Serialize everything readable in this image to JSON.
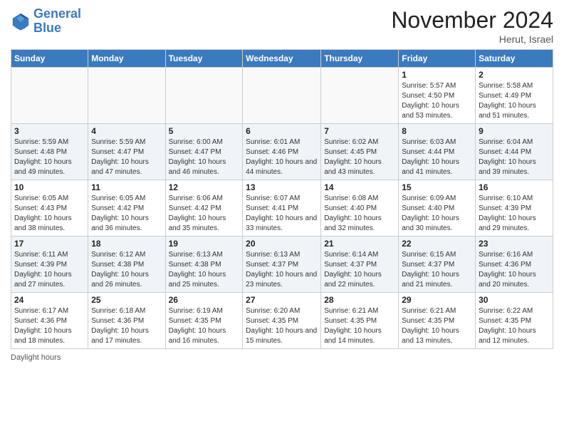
{
  "logo": {
    "text_general": "General",
    "text_blue": "Blue"
  },
  "header": {
    "month": "November 2024",
    "location": "Herut, Israel"
  },
  "days_of_week": [
    "Sunday",
    "Monday",
    "Tuesday",
    "Wednesday",
    "Thursday",
    "Friday",
    "Saturday"
  ],
  "weeks": [
    [
      {
        "day": "",
        "sunrise": "",
        "sunset": "",
        "daylight": ""
      },
      {
        "day": "",
        "sunrise": "",
        "sunset": "",
        "daylight": ""
      },
      {
        "day": "",
        "sunrise": "",
        "sunset": "",
        "daylight": ""
      },
      {
        "day": "",
        "sunrise": "",
        "sunset": "",
        "daylight": ""
      },
      {
        "day": "",
        "sunrise": "",
        "sunset": "",
        "daylight": ""
      },
      {
        "day": "1",
        "sunrise": "Sunrise: 5:57 AM",
        "sunset": "Sunset: 4:50 PM",
        "daylight": "Daylight: 10 hours and 53 minutes."
      },
      {
        "day": "2",
        "sunrise": "Sunrise: 5:58 AM",
        "sunset": "Sunset: 4:49 PM",
        "daylight": "Daylight: 10 hours and 51 minutes."
      }
    ],
    [
      {
        "day": "3",
        "sunrise": "Sunrise: 5:59 AM",
        "sunset": "Sunset: 4:48 PM",
        "daylight": "Daylight: 10 hours and 49 minutes."
      },
      {
        "day": "4",
        "sunrise": "Sunrise: 5:59 AM",
        "sunset": "Sunset: 4:47 PM",
        "daylight": "Daylight: 10 hours and 47 minutes."
      },
      {
        "day": "5",
        "sunrise": "Sunrise: 6:00 AM",
        "sunset": "Sunset: 4:47 PM",
        "daylight": "Daylight: 10 hours and 46 minutes."
      },
      {
        "day": "6",
        "sunrise": "Sunrise: 6:01 AM",
        "sunset": "Sunset: 4:46 PM",
        "daylight": "Daylight: 10 hours and 44 minutes."
      },
      {
        "day": "7",
        "sunrise": "Sunrise: 6:02 AM",
        "sunset": "Sunset: 4:45 PM",
        "daylight": "Daylight: 10 hours and 43 minutes."
      },
      {
        "day": "8",
        "sunrise": "Sunrise: 6:03 AM",
        "sunset": "Sunset: 4:44 PM",
        "daylight": "Daylight: 10 hours and 41 minutes."
      },
      {
        "day": "9",
        "sunrise": "Sunrise: 6:04 AM",
        "sunset": "Sunset: 4:44 PM",
        "daylight": "Daylight: 10 hours and 39 minutes."
      }
    ],
    [
      {
        "day": "10",
        "sunrise": "Sunrise: 6:05 AM",
        "sunset": "Sunset: 4:43 PM",
        "daylight": "Daylight: 10 hours and 38 minutes."
      },
      {
        "day": "11",
        "sunrise": "Sunrise: 6:05 AM",
        "sunset": "Sunset: 4:42 PM",
        "daylight": "Daylight: 10 hours and 36 minutes."
      },
      {
        "day": "12",
        "sunrise": "Sunrise: 6:06 AM",
        "sunset": "Sunset: 4:42 PM",
        "daylight": "Daylight: 10 hours and 35 minutes."
      },
      {
        "day": "13",
        "sunrise": "Sunrise: 6:07 AM",
        "sunset": "Sunset: 4:41 PM",
        "daylight": "Daylight: 10 hours and 33 minutes."
      },
      {
        "day": "14",
        "sunrise": "Sunrise: 6:08 AM",
        "sunset": "Sunset: 4:40 PM",
        "daylight": "Daylight: 10 hours and 32 minutes."
      },
      {
        "day": "15",
        "sunrise": "Sunrise: 6:09 AM",
        "sunset": "Sunset: 4:40 PM",
        "daylight": "Daylight: 10 hours and 30 minutes."
      },
      {
        "day": "16",
        "sunrise": "Sunrise: 6:10 AM",
        "sunset": "Sunset: 4:39 PM",
        "daylight": "Daylight: 10 hours and 29 minutes."
      }
    ],
    [
      {
        "day": "17",
        "sunrise": "Sunrise: 6:11 AM",
        "sunset": "Sunset: 4:39 PM",
        "daylight": "Daylight: 10 hours and 27 minutes."
      },
      {
        "day": "18",
        "sunrise": "Sunrise: 6:12 AM",
        "sunset": "Sunset: 4:38 PM",
        "daylight": "Daylight: 10 hours and 26 minutes."
      },
      {
        "day": "19",
        "sunrise": "Sunrise: 6:13 AM",
        "sunset": "Sunset: 4:38 PM",
        "daylight": "Daylight: 10 hours and 25 minutes."
      },
      {
        "day": "20",
        "sunrise": "Sunrise: 6:13 AM",
        "sunset": "Sunset: 4:37 PM",
        "daylight": "Daylight: 10 hours and 23 minutes."
      },
      {
        "day": "21",
        "sunrise": "Sunrise: 6:14 AM",
        "sunset": "Sunset: 4:37 PM",
        "daylight": "Daylight: 10 hours and 22 minutes."
      },
      {
        "day": "22",
        "sunrise": "Sunrise: 6:15 AM",
        "sunset": "Sunset: 4:37 PM",
        "daylight": "Daylight: 10 hours and 21 minutes."
      },
      {
        "day": "23",
        "sunrise": "Sunrise: 6:16 AM",
        "sunset": "Sunset: 4:36 PM",
        "daylight": "Daylight: 10 hours and 20 minutes."
      }
    ],
    [
      {
        "day": "24",
        "sunrise": "Sunrise: 6:17 AM",
        "sunset": "Sunset: 4:36 PM",
        "daylight": "Daylight: 10 hours and 18 minutes."
      },
      {
        "day": "25",
        "sunrise": "Sunrise: 6:18 AM",
        "sunset": "Sunset: 4:36 PM",
        "daylight": "Daylight: 10 hours and 17 minutes."
      },
      {
        "day": "26",
        "sunrise": "Sunrise: 6:19 AM",
        "sunset": "Sunset: 4:35 PM",
        "daylight": "Daylight: 10 hours and 16 minutes."
      },
      {
        "day": "27",
        "sunrise": "Sunrise: 6:20 AM",
        "sunset": "Sunset: 4:35 PM",
        "daylight": "Daylight: 10 hours and 15 minutes."
      },
      {
        "day": "28",
        "sunrise": "Sunrise: 6:21 AM",
        "sunset": "Sunset: 4:35 PM",
        "daylight": "Daylight: 10 hours and 14 minutes."
      },
      {
        "day": "29",
        "sunrise": "Sunrise: 6:21 AM",
        "sunset": "Sunset: 4:35 PM",
        "daylight": "Daylight: 10 hours and 13 minutes."
      },
      {
        "day": "30",
        "sunrise": "Sunrise: 6:22 AM",
        "sunset": "Sunset: 4:35 PM",
        "daylight": "Daylight: 10 hours and 12 minutes."
      }
    ]
  ],
  "footer": {
    "daylight_hours": "Daylight hours"
  }
}
